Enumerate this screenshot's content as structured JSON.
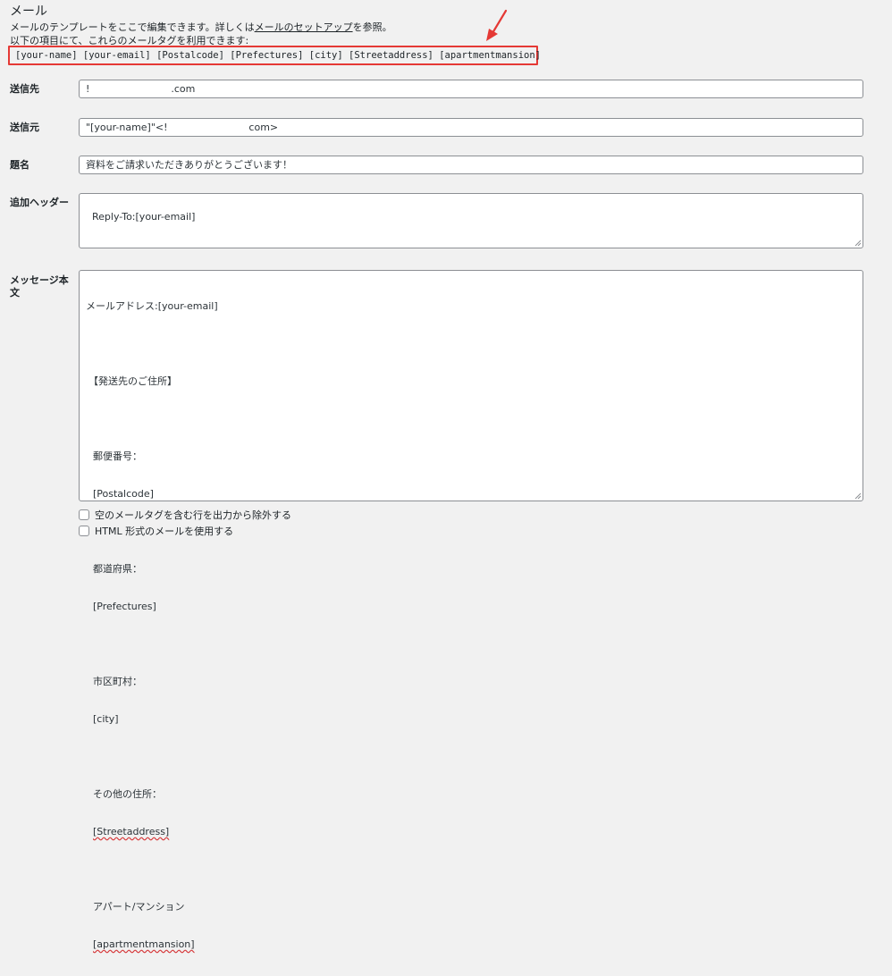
{
  "section": {
    "title": "メール",
    "desc1_pre": "メールのテンプレートをここで編集できます。詳しくは",
    "desc1_link": "メールのセットアップ",
    "desc1_post": "を参照。",
    "desc2": "以下の項目にて、これらのメールタグを利用できます:"
  },
  "mail_tags": [
    "[your-name]",
    "[your-email]",
    "[Postalcode]",
    "[Prefectures]",
    "[city]",
    "[Streetaddress]",
    "[apartmentmansion]"
  ],
  "fields": {
    "to": {
      "label": "送信先",
      "value": "!                          .com"
    },
    "from": {
      "label": "送信元",
      "value": "\"[your-name]\"<!                          com>"
    },
    "subject": {
      "label": "題名",
      "value": "資料をご請求いただきありがとうございます！"
    },
    "headers": {
      "label": "追加ヘッダー",
      "value": "Reply-To:[your-email]"
    },
    "body": {
      "label_line1": "メッセージ本",
      "label_line2": "文",
      "lines": [
        "メールアドレス:[your-email]",
        "",
        "【発送先のご住所】",
        "",
        "郵便番号：",
        "[Postalcode]",
        "",
        "都道府県：",
        "[Prefectures]",
        "",
        "市区町村：",
        "[city]",
        "",
        "その他の住所：",
        "[Streetaddress]",
        "",
        "アパート/マンション",
        "[apartmentmansion]"
      ]
    }
  },
  "options": {
    "exclude_blank": "空のメールタグを含む行を出力から除外する",
    "use_html": "HTML 形式のメールを使用する"
  },
  "colors": {
    "highlight": "#e53935"
  }
}
